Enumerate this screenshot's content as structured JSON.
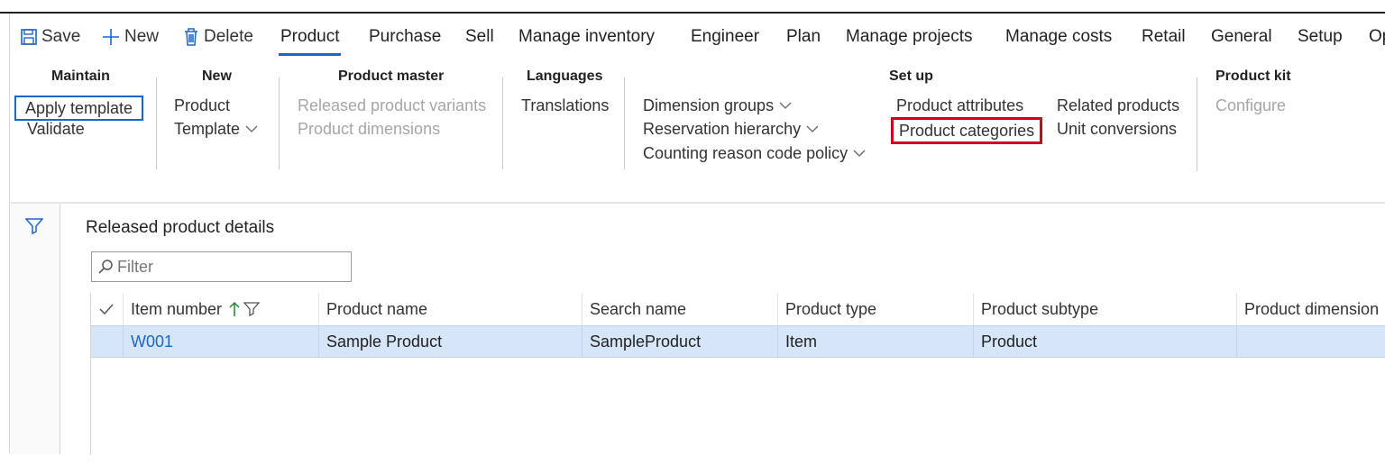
{
  "action_bar": {
    "save_label": "Save",
    "new_label": "New",
    "delete_label": "Delete",
    "tabs": [
      "Product",
      "Purchase",
      "Sell",
      "Manage inventory",
      "Engineer",
      "Plan",
      "Manage projects",
      "Manage costs",
      "Retail",
      "General",
      "Setup",
      "Op"
    ],
    "active_tab": "Product"
  },
  "ribbon": {
    "maintain": {
      "title": "Maintain",
      "items": [
        "Apply template",
        "Validate"
      ]
    },
    "new": {
      "title": "New",
      "items": [
        "Product",
        "Template"
      ]
    },
    "product_master": {
      "title": "Product master",
      "items": [
        "Released product variants",
        "Product dimensions"
      ]
    },
    "languages": {
      "title": "Languages",
      "items": [
        "Translations"
      ]
    },
    "setup": {
      "title": "Set up",
      "col1": [
        "Dimension groups",
        "Reservation hierarchy",
        "Counting reason code policy"
      ],
      "col2": [
        "Product attributes",
        "Product categories"
      ],
      "col3": [
        "Related products",
        "Unit conversions"
      ]
    },
    "product_kit": {
      "title": "Product kit",
      "items": [
        "Configure"
      ]
    }
  },
  "details": {
    "title": "Released product details",
    "filter_placeholder": "Filter"
  },
  "grid": {
    "columns": [
      "Item number",
      "Product name",
      "Search name",
      "Product type",
      "Product subtype",
      "Product dimension"
    ],
    "rows": [
      [
        "W001",
        "Sample Product",
        "SampleProduct",
        "Item",
        "Product",
        ""
      ]
    ]
  },
  "colors": {
    "accent": "#1b66c9",
    "highlight": "#d0021b",
    "selected_row": "#d6e5f7"
  }
}
